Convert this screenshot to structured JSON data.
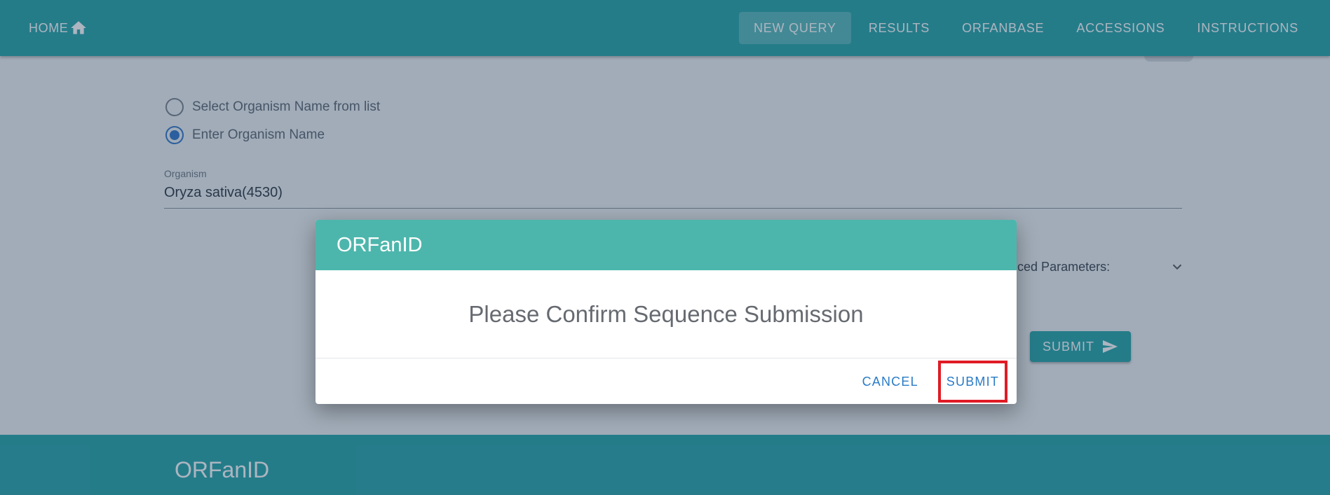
{
  "nav": {
    "home_label": "HOME",
    "links": [
      {
        "label": "NEW QUERY",
        "active": true
      },
      {
        "label": "RESULTS",
        "active": false
      },
      {
        "label": "ORFANBASE",
        "active": false
      },
      {
        "label": "ACCESSIONS",
        "active": false
      },
      {
        "label": "INSTRUCTIONS",
        "active": false
      }
    ]
  },
  "form": {
    "radio_options": [
      {
        "label": "Select Organism Name from list",
        "checked": false
      },
      {
        "label": "Enter Organism Name",
        "checked": true
      }
    ],
    "organism_label": "Organism",
    "organism_value": "Oryza sativa(4530)",
    "advanced_label": "Advanced Parameters:",
    "submit_label": "SUBMIT"
  },
  "dialog": {
    "title": "ORFanID",
    "message": "Please Confirm Sequence Submission",
    "cancel_label": "CANCEL",
    "submit_label": "SUBMIT"
  },
  "footer": {
    "title": "ORFanID"
  },
  "colors": {
    "primary": "#26a4a7",
    "dialog_header": "#4db6ac",
    "button_text": "#2a7bc6",
    "highlight": "#e01b24"
  }
}
